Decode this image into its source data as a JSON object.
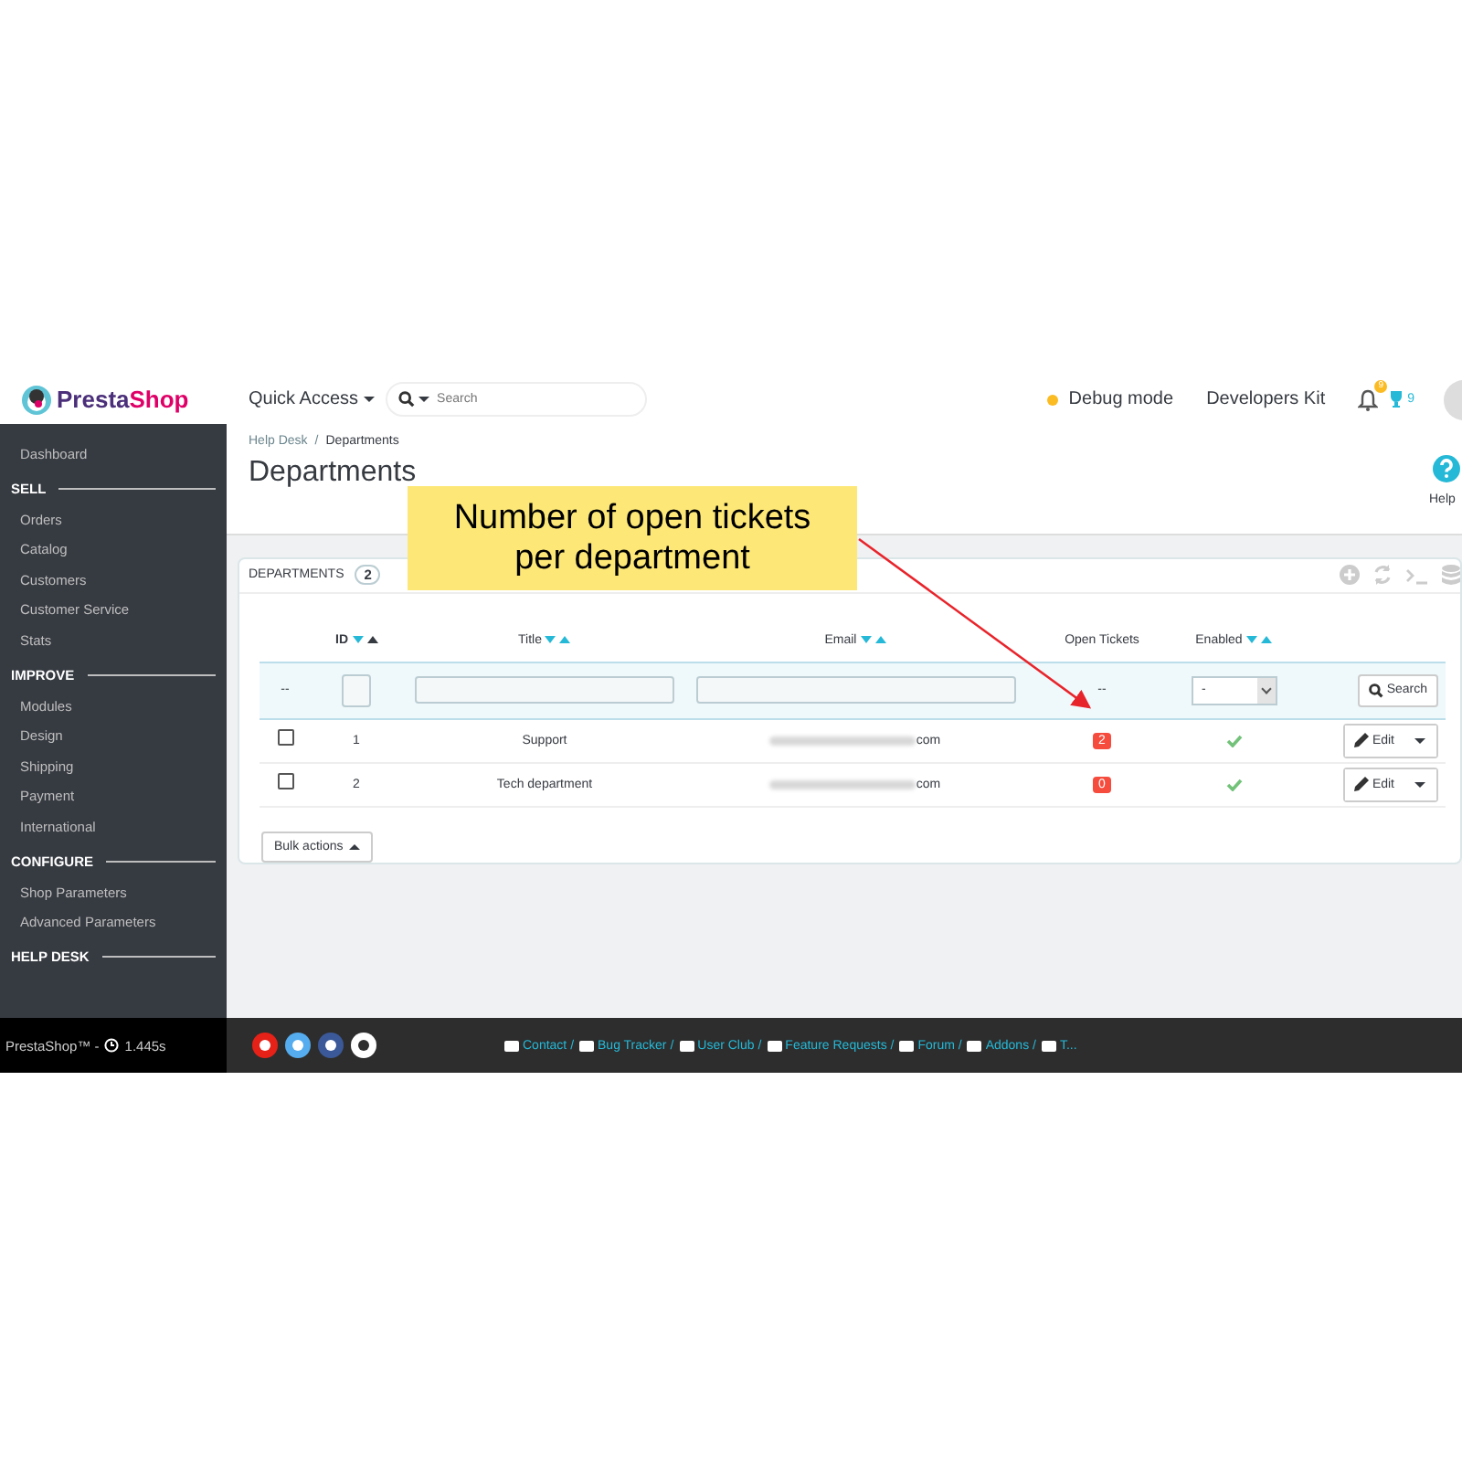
{
  "header": {
    "logo": {
      "first": "Presta",
      "second": "Shop"
    },
    "quick_access": "Quick Access",
    "search": {
      "placeholder": "Search"
    },
    "debug": "Debug mode",
    "dev_kit": "Developers Kit",
    "notifications": "9",
    "trophies": "9"
  },
  "sidebar": [
    {
      "kind": "item",
      "label": "Dashboard"
    },
    {
      "kind": "section",
      "label": "SELL"
    },
    {
      "kind": "item",
      "label": "Orders"
    },
    {
      "kind": "item",
      "label": "Catalog"
    },
    {
      "kind": "item",
      "label": "Customers"
    },
    {
      "kind": "item",
      "label": "Customer Service"
    },
    {
      "kind": "item",
      "label": "Stats"
    },
    {
      "kind": "section",
      "label": "IMPROVE"
    },
    {
      "kind": "item",
      "label": "Modules"
    },
    {
      "kind": "item",
      "label": "Design"
    },
    {
      "kind": "item",
      "label": "Shipping"
    },
    {
      "kind": "item",
      "label": "Payment"
    },
    {
      "kind": "item",
      "label": "International"
    },
    {
      "kind": "section",
      "label": "CONFIGURE"
    },
    {
      "kind": "item",
      "label": "Shop Parameters"
    },
    {
      "kind": "item",
      "label": "Advanced Parameters"
    },
    {
      "kind": "section",
      "label": "HELP DESK"
    }
  ],
  "breadcrumb": [
    "Help Desk",
    "Departments"
  ],
  "page_title": "Departments",
  "help": "Help",
  "panel": {
    "title": "DEPARTMENTS",
    "count": "2"
  },
  "breadcrumb_separator": "/",
  "columns": [
    {
      "label": "ID",
      "sortable": true,
      "sorted_ascending": true
    },
    {
      "label": "Title",
      "sortable": true,
      "sorted_ascending": false
    },
    {
      "label": "Email",
      "sortable": true,
      "sorted_ascending": false
    },
    {
      "label": "Open Tickets",
      "sortable": false
    },
    {
      "label": "Enabled",
      "sortable": true,
      "sorted_ascending": false
    }
  ],
  "filters": {
    "checkbox_col": "--",
    "open_tickets": "--",
    "enabled_select": "-",
    "search_button": "Search"
  },
  "rows": [
    {
      "selected": false,
      "id": "1",
      "title": "Support",
      "email": "com",
      "open_tickets": "2",
      "enabled": true,
      "action": "Edit"
    },
    {
      "selected": false,
      "id": "2",
      "title": "Tech department",
      "email": "com",
      "open_tickets": "0",
      "enabled": true,
      "action": "Edit"
    }
  ],
  "bulk_actions": "Bulk actions",
  "annotation": {
    "lines": [
      "Number of open tickets",
      "per department"
    ]
  },
  "footer": {
    "brand": "PrestaShop™ -",
    "time": "1.445s",
    "links": [
      "Contact /",
      "Bug Tracker /",
      "User Club /",
      "Feature Requests /",
      "Forum /",
      "Addons /",
      "T..."
    ]
  }
}
